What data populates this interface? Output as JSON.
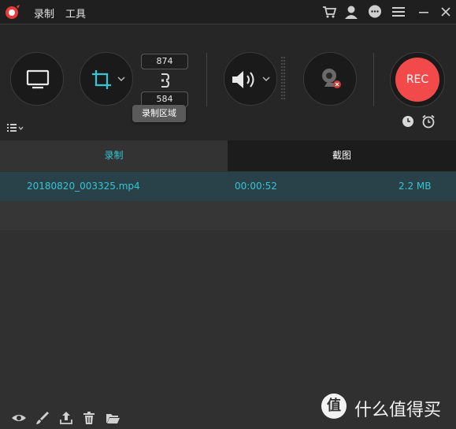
{
  "menu": {
    "record": "录制",
    "tools": "工具"
  },
  "titlebar_icons": [
    "cart-icon",
    "user-icon",
    "chat-icon",
    "menu-icon",
    "minimize-icon",
    "close-icon"
  ],
  "dimensions": {
    "width": "874",
    "height": "584"
  },
  "tooltip": "录制区域",
  "rec_label": "REC",
  "tabs": {
    "record": "录制",
    "screenshot": "截图"
  },
  "recordings": [
    {
      "filename": "20180820_003325.mp4",
      "duration": "00:00:52",
      "size": "2.2 MB"
    }
  ],
  "watermark": {
    "text": "什么值得买",
    "mark": "值"
  },
  "colors": {
    "accent": "#35c6d6",
    "rec": "#f24a4a"
  }
}
